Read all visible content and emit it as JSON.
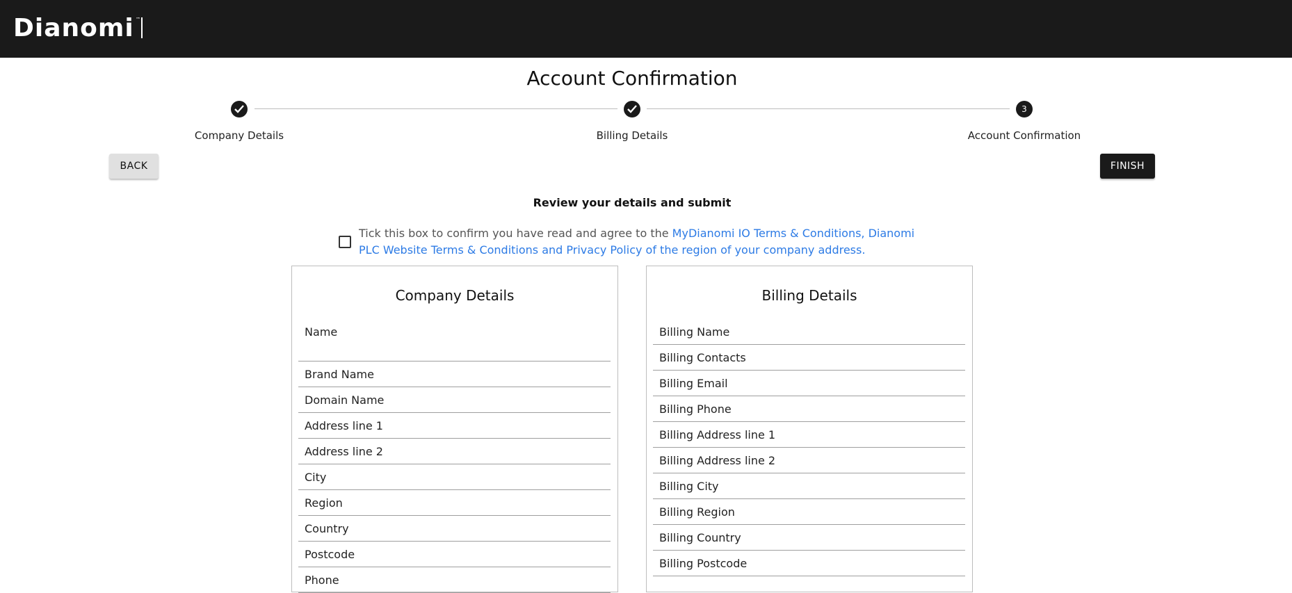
{
  "header": {
    "logo_text": "Dianomi",
    "logo_tm": "™"
  },
  "page": {
    "title": "Account Confirmation"
  },
  "stepper": {
    "steps": [
      {
        "label": "Company Details",
        "status": "complete",
        "icon": "check-icon"
      },
      {
        "label": "Billing Details",
        "status": "complete",
        "icon": "check-icon"
      },
      {
        "label": "Account Confirmation",
        "status": "active",
        "number": "3"
      }
    ]
  },
  "actions": {
    "back_label": "BACK",
    "finish_label": "FINISH"
  },
  "review": {
    "heading": "Review your details and submit",
    "terms_prefix": "Tick this box to confirm you have read and agree to the ",
    "terms_link_text": "MyDianomi IO Terms & Conditions, Dianomi PLC Website Terms & Conditions and Privacy Policy of the region of your company address.",
    "checked": false
  },
  "company_details": {
    "title": "Company Details",
    "fields": [
      "Name",
      "Brand Name",
      "Domain Name",
      "Address line 1",
      "Address line 2",
      "City",
      "Region",
      "Country",
      "Postcode",
      "Phone"
    ]
  },
  "billing_details": {
    "title": "Billing Details",
    "fields": [
      "Billing Name",
      "Billing Contacts",
      "Billing Email",
      "Billing Phone",
      "Billing Address line 1",
      "Billing Address line 2",
      "Billing City",
      "Billing Region",
      "Billing Country",
      "Billing Postcode"
    ]
  },
  "colors": {
    "header_bg": "#1a1a1a",
    "link": "#2d7be5",
    "primary_button": "#1a1a1a",
    "secondary_button": "#e0e0e0"
  }
}
